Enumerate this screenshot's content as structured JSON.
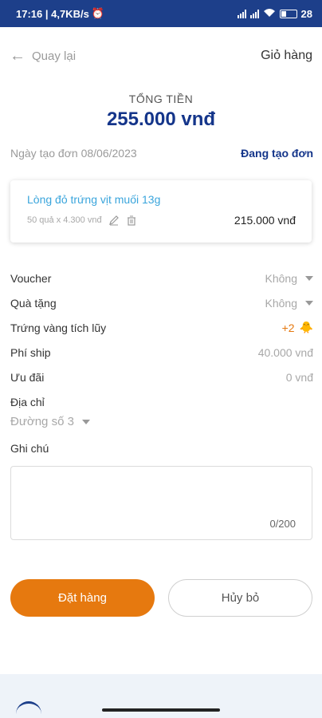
{
  "status_bar": {
    "time_speed": "17:16 | 4,7KB/s",
    "battery": "28"
  },
  "header": {
    "back_label": "Quay lại",
    "title": "Giỏ hàng"
  },
  "total": {
    "label": "TỔNG TIỀN",
    "amount": "255.000 vnđ"
  },
  "order": {
    "created_date": "Ngày tạo đơn 08/06/2023",
    "status": "Đang tạo đơn"
  },
  "cart_item": {
    "name": "Lòng đỏ trứng vịt muối 13g",
    "qty_detail": "50 quả x 4.300 vnđ",
    "price": "215.000 vnđ"
  },
  "summary": {
    "voucher": {
      "label": "Voucher",
      "value": "Không"
    },
    "gift": {
      "label": "Quà tặng",
      "value": "Không"
    },
    "points": {
      "label": "Trứng vàng tích lũy",
      "value": "+2"
    },
    "shipping": {
      "label": "Phí ship",
      "value": "40.000 vnđ"
    },
    "discount": {
      "label": "Ưu đãi",
      "value": "0 vnđ"
    },
    "address": {
      "label": "Địa chỉ",
      "value": "Đường số 3"
    }
  },
  "note": {
    "label": "Ghi chú",
    "counter": "0/200"
  },
  "actions": {
    "order_label": "Đặt hàng",
    "cancel_label": "Hủy bỏ"
  },
  "colors": {
    "primary_blue": "#14358a",
    "accent_orange": "#e6790f",
    "link_blue": "#3aa5dc"
  }
}
